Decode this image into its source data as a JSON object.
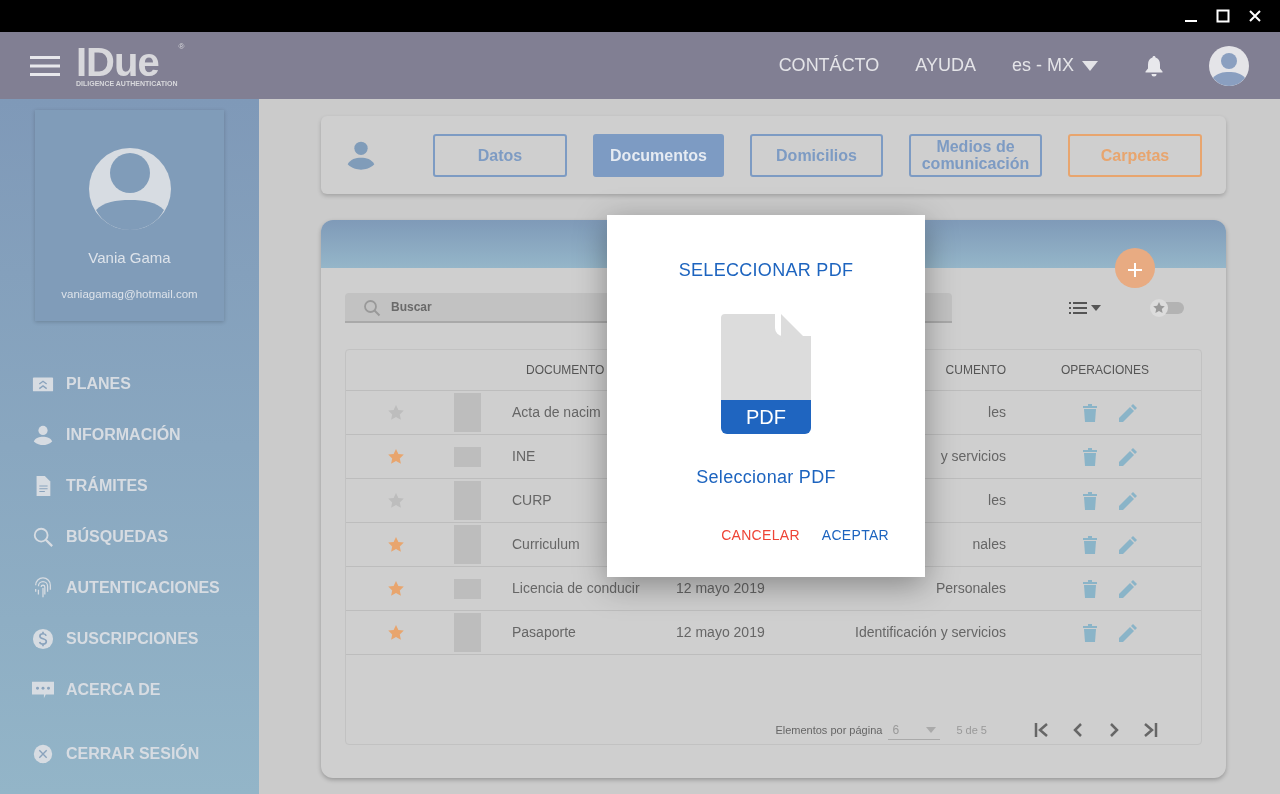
{
  "header": {
    "logo": "IDue",
    "logo_tagline": "DILIGENCE AUTHENTICATION",
    "logo_mark": "®",
    "nav": [
      "CONTÁCTO",
      "AYUDA"
    ],
    "language": "es - MX"
  },
  "profile": {
    "name": "Vania Gama",
    "email": "vaniagamag@hotmail.com"
  },
  "sidebar": {
    "items": [
      {
        "label": "PLANES"
      },
      {
        "label": "INFORMACIÓN"
      },
      {
        "label": "TRÁMITES"
      },
      {
        "label": "BÚSQUEDAS"
      },
      {
        "label": "AUTENTICACIONES"
      },
      {
        "label": "SUSCRIPCIONES"
      },
      {
        "label": "ACERCA DE"
      },
      {
        "label": "CERRAR SESIÓN"
      }
    ]
  },
  "tabs": [
    {
      "label": "Datos",
      "selected": false,
      "color": "#7d9bc3"
    },
    {
      "label": "Documentos",
      "selected": true,
      "color": "#7d9bc3"
    },
    {
      "label": "Domicilios",
      "selected": false,
      "color": "#7d9bc3"
    },
    {
      "label": "Medios de comunicación",
      "selected": false,
      "color": "#7d9bc3"
    },
    {
      "label": "Carpetas",
      "selected": false,
      "color": "#e8a56e"
    }
  ],
  "search": {
    "placeholder": "Buscar"
  },
  "favorites_toggle": {
    "on": false
  },
  "table": {
    "columns": [
      "DOCUMENTO",
      "CUMENTO",
      "OPERACIONES"
    ],
    "rows": [
      {
        "starred": false,
        "kind": "portrait",
        "document": "Acta de nacim",
        "type": "les"
      },
      {
        "starred": true,
        "kind": "landscape",
        "document": "INE",
        "type": "y servicios"
      },
      {
        "starred": false,
        "kind": "portrait",
        "document": "CURP",
        "type": "les"
      },
      {
        "starred": true,
        "kind": "portrait",
        "document": "Curriculum",
        "type": "nales"
      },
      {
        "starred": true,
        "kind": "landscape",
        "document": "Licencia de conducir",
        "date": "12 mayo 2019",
        "type": "Personales"
      },
      {
        "starred": true,
        "kind": "portrait",
        "document": "Pasaporte",
        "date": "12 mayo 2019",
        "type": "Identificación y servicios"
      }
    ]
  },
  "paginator": {
    "label": "Elementos por página",
    "page_size": "6",
    "range": "5 de 5"
  },
  "dialog": {
    "title": "SELECCIONAR PDF",
    "file_badge": "PDF",
    "link": "Seleccionar PDF",
    "buttons": [
      {
        "label": "CANCELAR",
        "kind": "cancel"
      },
      {
        "label": "ACEPTAR",
        "kind": "accept"
      }
    ]
  }
}
